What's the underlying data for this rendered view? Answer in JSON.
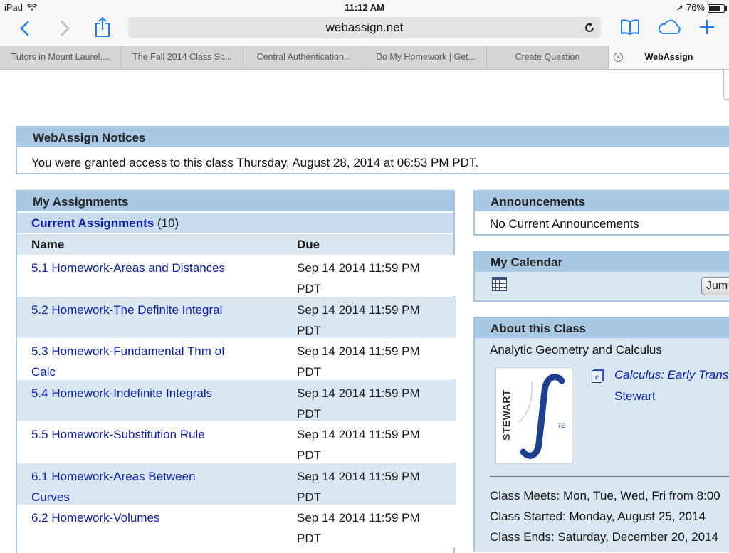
{
  "status_bar": {
    "device": "iPad",
    "time": "11:12 AM",
    "battery": "76%"
  },
  "browser": {
    "url": "webassign.net",
    "tabs": [
      {
        "label": "Tutors in Mount Laurel,..."
      },
      {
        "label": "The Fall 2014 Class Sc..."
      },
      {
        "label": "Central Authentication..."
      },
      {
        "label": "Do My Homework | Get..."
      },
      {
        "label": "Create Question"
      },
      {
        "label": "WebAssign"
      }
    ]
  },
  "notices": {
    "title": "WebAssign Notices",
    "text": "You were granted access to this class Thursday, August 28, 2014 at 06:53 PM PDT."
  },
  "assignments": {
    "title": "My Assignments",
    "current_label": "Current Assignments",
    "count": "(10)",
    "col_name": "Name",
    "col_due": "Due",
    "rows": [
      {
        "name": "5.1 Homework-Areas and Distances",
        "due": "Sep 14 2014 11:59 PM",
        "tz": "PDT"
      },
      {
        "name": "5.2 Homework-The Definite Integral",
        "due": "Sep 14 2014 11:59 PM",
        "tz": "PDT"
      },
      {
        "name": "5.3 Homework-Fundamental Thm of",
        "name2": "Calc",
        "due": "Sep 14 2014 11:59 PM",
        "tz": "PDT"
      },
      {
        "name": "5.4 Homework-Indefinite Integrals",
        "due": "Sep 14 2014 11:59 PM",
        "tz": "PDT"
      },
      {
        "name": "5.5 Homework-Substitution Rule",
        "due": "Sep 14 2014 11:59 PM",
        "tz": "PDT"
      },
      {
        "name": "6.1 Homework-Areas Between",
        "name2": "Curves",
        "due": "Sep 14 2014 11:59 PM",
        "tz": "PDT"
      },
      {
        "name": "6.2 Homework-Volumes",
        "due": "Sep 14 2014 11:59 PM",
        "tz": "PDT"
      }
    ]
  },
  "announcements": {
    "title": "Announcements",
    "text": "No Current Announcements"
  },
  "calendar": {
    "title": "My Calendar",
    "jump_label": "Jum"
  },
  "about": {
    "title": "About this Class",
    "class_name": "Analytic Geometry and Calculus",
    "book_title": "Calculus: Early Trans",
    "book_author": "Stewart",
    "book_cover_text": "STEWART",
    "book_edition": "7E",
    "meets": "Class Meets: Mon, Tue, Wed, Fri from 8:00",
    "started": "Class Started: Monday, August 25, 2014",
    "ends": "Class Ends: Saturday, December 20, 2014"
  }
}
